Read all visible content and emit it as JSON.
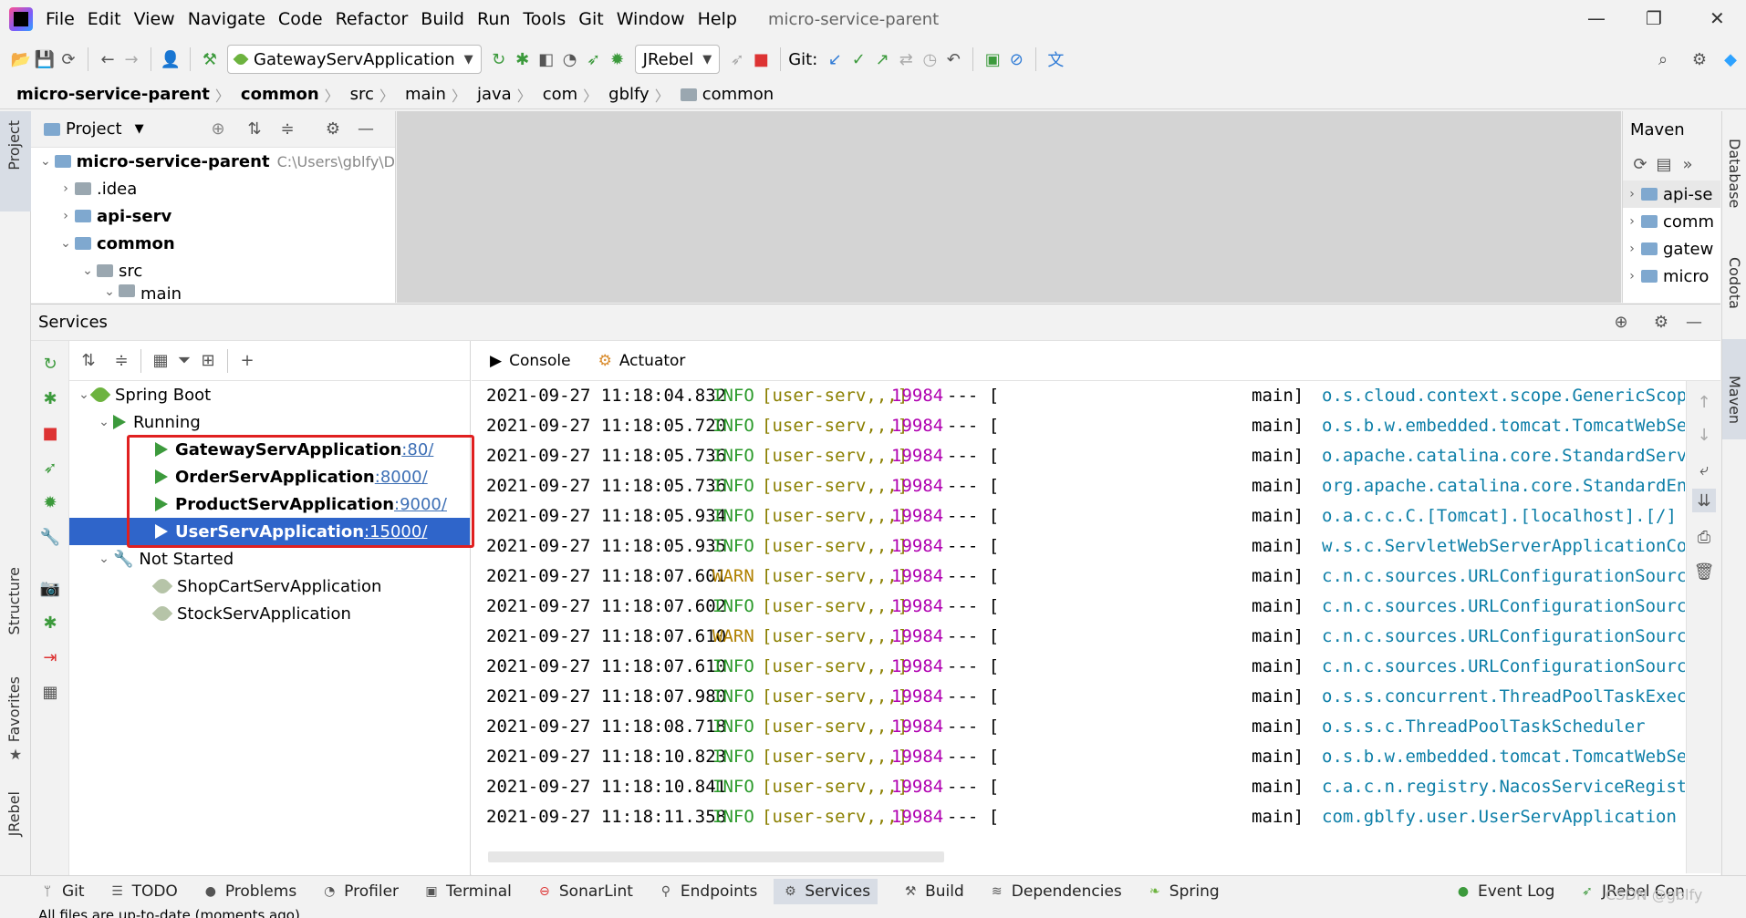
{
  "menubar": {
    "items": [
      "File",
      "Edit",
      "View",
      "Navigate",
      "Code",
      "Refactor",
      "Build",
      "Run",
      "Tools",
      "Git",
      "Window",
      "Help"
    ],
    "project_title": "micro-service-parent"
  },
  "toolbar": {
    "run_config": "GatewayServApplication",
    "jrebel": "JRebel",
    "git_label": "Git:"
  },
  "breadcrumb": [
    "micro-service-parent",
    "common",
    "src",
    "main",
    "java",
    "com",
    "gblfy",
    "common"
  ],
  "left_stripe": {
    "project": "Project",
    "structure": "Structure",
    "favorites": "Favorites",
    "jrebel": "JRebel"
  },
  "right_stripe": {
    "database": "Database",
    "codota": "Codota",
    "maven": "Maven"
  },
  "project_panel": {
    "title": "Project",
    "root": "micro-service-parent",
    "root_path": "C:\\Users\\gblfy\\D",
    "items": [
      {
        "label": ".idea"
      },
      {
        "label": "api-serv"
      },
      {
        "label": "common"
      },
      {
        "label": "src"
      },
      {
        "label": "main"
      }
    ]
  },
  "maven_panel": {
    "title": "Maven",
    "items": [
      "api-se",
      "comm",
      "gatew",
      "micro"
    ]
  },
  "services": {
    "title": "Services",
    "tree": {
      "root": "Spring Boot",
      "running_label": "Running",
      "running": [
        {
          "name": "GatewayServApplication",
          "port": ":80/"
        },
        {
          "name": "OrderServApplication",
          "port": ":8000/"
        },
        {
          "name": "ProductServApplication",
          "port": ":9000/"
        },
        {
          "name": "UserServApplication",
          "port": ":15000/"
        }
      ],
      "not_started_label": "Not Started",
      "not_started": [
        "ShopCartServApplication",
        "StockServApplication"
      ]
    },
    "tabs": [
      "Console",
      "Actuator"
    ]
  },
  "log": [
    {
      "date": "2021-09-27 11:18:04.832",
      "level": "INFO",
      "app": "[user-serv,,,]",
      "pid": "19984",
      "dash": "--- [",
      "thread": "main]",
      "logger": "o.s.cloud.context.scope.GenericScope"
    },
    {
      "date": "2021-09-27 11:18:05.720",
      "level": "INFO",
      "app": "[user-serv,,,]",
      "pid": "19984",
      "dash": "--- [",
      "thread": "main]",
      "logger": "o.s.b.w.embedded.tomcat.TomcatWebSer"
    },
    {
      "date": "2021-09-27 11:18:05.736",
      "level": "INFO",
      "app": "[user-serv,,,]",
      "pid": "19984",
      "dash": "--- [",
      "thread": "main]",
      "logger": "o.apache.catalina.core.StandardServic"
    },
    {
      "date": "2021-09-27 11:18:05.736",
      "level": "INFO",
      "app": "[user-serv,,,]",
      "pid": "19984",
      "dash": "--- [",
      "thread": "main]",
      "logger": "org.apache.catalina.core.StandardEng:"
    },
    {
      "date": "2021-09-27 11:18:05.934",
      "level": "INFO",
      "app": "[user-serv,,,]",
      "pid": "19984",
      "dash": "--- [",
      "thread": "main]",
      "logger": "o.a.c.c.C.[Tomcat].[localhost].[/]"
    },
    {
      "date": "2021-09-27 11:18:05.935",
      "level": "INFO",
      "app": "[user-serv,,,]",
      "pid": "19984",
      "dash": "--- [",
      "thread": "main]",
      "logger": "w.s.c.ServletWebServerApplicationCon"
    },
    {
      "date": "2021-09-27 11:18:07.601",
      "level": "WARN",
      "app": "[user-serv,,,]",
      "pid": "19984",
      "dash": "--- [",
      "thread": "main]",
      "logger": "c.n.c.sources.URLConfigurationSource"
    },
    {
      "date": "2021-09-27 11:18:07.602",
      "level": "INFO",
      "app": "[user-serv,,,]",
      "pid": "19984",
      "dash": "--- [",
      "thread": "main]",
      "logger": "c.n.c.sources.URLConfigurationSource"
    },
    {
      "date": "2021-09-27 11:18:07.610",
      "level": "WARN",
      "app": "[user-serv,,,]",
      "pid": "19984",
      "dash": "--- [",
      "thread": "main]",
      "logger": "c.n.c.sources.URLConfigurationSource"
    },
    {
      "date": "2021-09-27 11:18:07.610",
      "level": "INFO",
      "app": "[user-serv,,,]",
      "pid": "19984",
      "dash": "--- [",
      "thread": "main]",
      "logger": "c.n.c.sources.URLConfigurationSource"
    },
    {
      "date": "2021-09-27 11:18:07.980",
      "level": "INFO",
      "app": "[user-serv,,,]",
      "pid": "19984",
      "dash": "--- [",
      "thread": "main]",
      "logger": "o.s.s.concurrent.ThreadPoolTaskExecu"
    },
    {
      "date": "2021-09-27 11:18:08.718",
      "level": "INFO",
      "app": "[user-serv,,,]",
      "pid": "19984",
      "dash": "--- [",
      "thread": "main]",
      "logger": "o.s.s.c.ThreadPoolTaskScheduler"
    },
    {
      "date": "2021-09-27 11:18:10.823",
      "level": "INFO",
      "app": "[user-serv,,,]",
      "pid": "19984",
      "dash": "--- [",
      "thread": "main]",
      "logger": "o.s.b.w.embedded.tomcat.TomcatWebSer"
    },
    {
      "date": "2021-09-27 11:18:10.841",
      "level": "INFO",
      "app": "[user-serv,,,]",
      "pid": "19984",
      "dash": "--- [",
      "thread": "main]",
      "logger": "c.a.c.n.registry.NacosServiceRegistr"
    },
    {
      "date": "2021-09-27 11:18:11.358",
      "level": "INFO",
      "app": "[user-serv,,,]",
      "pid": "19984",
      "dash": "--- [",
      "thread": "main]",
      "logger": "com.gblfy.user.UserServApplication"
    }
  ],
  "bottom_tabs": [
    "Git",
    "TODO",
    "Problems",
    "Profiler",
    "Terminal",
    "SonarLint",
    "Endpoints",
    "Services",
    "Build",
    "Dependencies",
    "Spring"
  ],
  "bottom_right": [
    "Event Log",
    "JRebel Con"
  ],
  "status": "All files are up-to-date (moments ago)",
  "watermark": "CSDN @gblfy",
  "colors": {
    "selection": "#2f65ca",
    "info": "#2a9a2a",
    "warn": "#b08000",
    "pid": "#b000b0",
    "logger": "#0e7fa8",
    "highlight_box": "#e02020"
  }
}
